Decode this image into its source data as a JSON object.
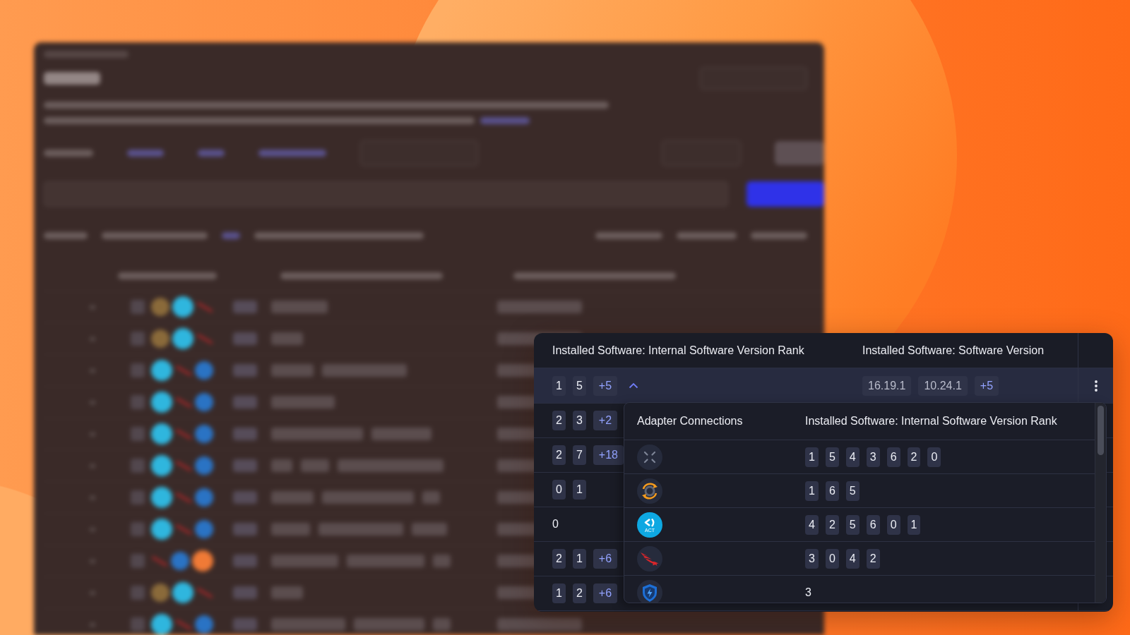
{
  "table": {
    "columns": [
      {
        "label": "Installed Software: Internal Software Version Rank"
      },
      {
        "label": "Installed Software: Software Version"
      }
    ],
    "rows": [
      {
        "selected": true,
        "expanded": true,
        "internal_version_rank": {
          "kind": "chips",
          "values": [
            "1",
            "5"
          ],
          "more": "+5"
        },
        "software_version": {
          "kind": "chips",
          "values": [
            "16.19.1",
            "10.24.1"
          ],
          "more": "+5"
        }
      },
      {
        "selected": false,
        "internal_version_rank": {
          "kind": "chips",
          "values": [
            "2",
            "3"
          ],
          "more": "+2"
        }
      },
      {
        "selected": false,
        "internal_version_rank": {
          "kind": "chips",
          "values": [
            "2",
            "7"
          ],
          "more": "+18"
        }
      },
      {
        "selected": false,
        "internal_version_rank": {
          "kind": "chips",
          "values": [
            "0",
            "1"
          ]
        }
      },
      {
        "selected": false,
        "internal_version_rank": {
          "kind": "text",
          "value": "0"
        }
      },
      {
        "selected": false,
        "internal_version_rank": {
          "kind": "chips",
          "values": [
            "2",
            "1"
          ],
          "more": "+6"
        }
      },
      {
        "selected": false,
        "internal_version_rank": {
          "kind": "chips",
          "values": [
            "1",
            "2"
          ],
          "more": "+6"
        }
      }
    ]
  },
  "popover": {
    "columns": [
      {
        "label": "Adapter Connections"
      },
      {
        "label": "Installed Software: Internal Software Version Rank"
      }
    ],
    "rows": [
      {
        "adapter": {
          "kind": "cross"
        },
        "internal_version_rank": {
          "kind": "chips",
          "values": [
            "1",
            "5",
            "4",
            "3",
            "6",
            "2",
            "0"
          ]
        }
      },
      {
        "adapter": {
          "kind": "cycle"
        },
        "internal_version_rank": {
          "kind": "chips",
          "values": [
            "1",
            "6",
            "5"
          ]
        }
      },
      {
        "adapter": {
          "kind": "act",
          "logo_text": "ACT"
        },
        "internal_version_rank": {
          "kind": "chips",
          "values": [
            "4",
            "2",
            "5",
            "6",
            "0",
            "1"
          ]
        }
      },
      {
        "adapter": {
          "kind": "bird"
        },
        "internal_version_rank": {
          "kind": "chips",
          "values": [
            "3",
            "0",
            "4",
            "2"
          ]
        }
      },
      {
        "adapter": {
          "kind": "shield"
        },
        "internal_version_rank": {
          "kind": "text",
          "value": "3"
        }
      }
    ]
  }
}
